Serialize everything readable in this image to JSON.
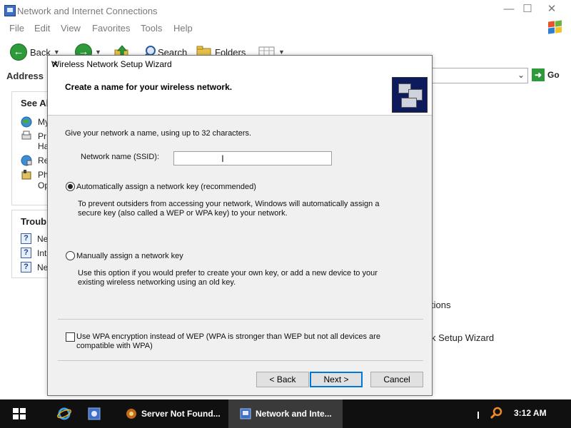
{
  "explorer": {
    "title": "Network and Internet Connections",
    "menu": [
      "File",
      "Edit",
      "View",
      "Favorites",
      "Tools",
      "Help"
    ],
    "toolbar": {
      "back": "Back",
      "search": "Search",
      "folders": "Folders"
    },
    "address_label": "Address",
    "go_label": "Go",
    "see_also_head": "See Al",
    "see_also_items": [
      "My",
      "Pr",
      "Ha",
      "Re",
      "Ph",
      "Op"
    ],
    "troubleshoot_head": "Trouble",
    "troubleshoot_items": [
      "Ne",
      "Int",
      "Ne"
    ],
    "task_fragment_1": "tions",
    "task_fragment_2": "k Setup Wizard"
  },
  "dialog": {
    "title": "Wireless Network Setup Wizard",
    "header": "Create a name for your wireless network.",
    "intro": "Give your network a name, using up to 32 characters.",
    "ssid_label": "Network name (SSID):",
    "ssid_value": "",
    "auto_key": {
      "label": "Automatically assign a network key (recommended)",
      "selected": true,
      "desc_line1": "To prevent outsiders from accessing your network, Windows will automatically assign a",
      "desc_line2": "secure key (also called a WEP or WPA key) to your network."
    },
    "manual_key": {
      "label": "Manually assign a network key",
      "selected": false,
      "desc_line1": "Use this option if you would prefer to create your own key, or add a new device to your",
      "desc_line2": "existing wireless networking using an old key."
    },
    "wpa": {
      "line1": "Use WPA encryption instead of WEP (WPA is stronger than WEP but not all devices are",
      "line2": "compatible with WPA)",
      "checked": false
    },
    "buttons": {
      "back": "< Back",
      "next": "Next >",
      "cancel": "Cancel"
    }
  },
  "taskbar": {
    "tasks": [
      "Server Not Found...",
      "Network and Inte..."
    ],
    "clock": "3:12 AM"
  },
  "colors": {
    "accent": "#0078d7",
    "taskbar": "#101010",
    "dialog_bg": "#f0f0f0",
    "green": "#2e9a3a"
  }
}
